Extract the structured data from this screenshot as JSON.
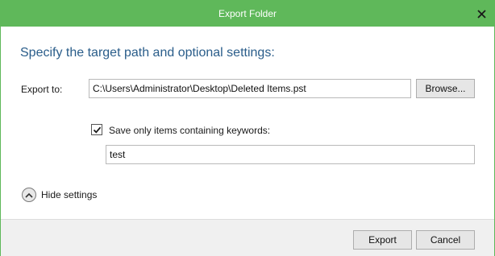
{
  "window": {
    "title": "Export Folder"
  },
  "heading": "Specify the target path and optional settings:",
  "export": {
    "label": "Export to:",
    "path_value": "C:\\Users\\Administrator\\Desktop\\Deleted Items.pst",
    "browse_label": "Browse..."
  },
  "keywords": {
    "checkbox_label": "Save only items containing keywords:",
    "checked": true,
    "value": "test"
  },
  "settings_toggle_label": "Hide settings",
  "footer": {
    "export_label": "Export",
    "cancel_label": "Cancel"
  },
  "colors": {
    "accent": "#5fb85a",
    "heading": "#2a5d8a"
  },
  "icons": {
    "close": "close-icon",
    "check": "checkmark-icon",
    "toggle": "chevron-up-icon"
  }
}
